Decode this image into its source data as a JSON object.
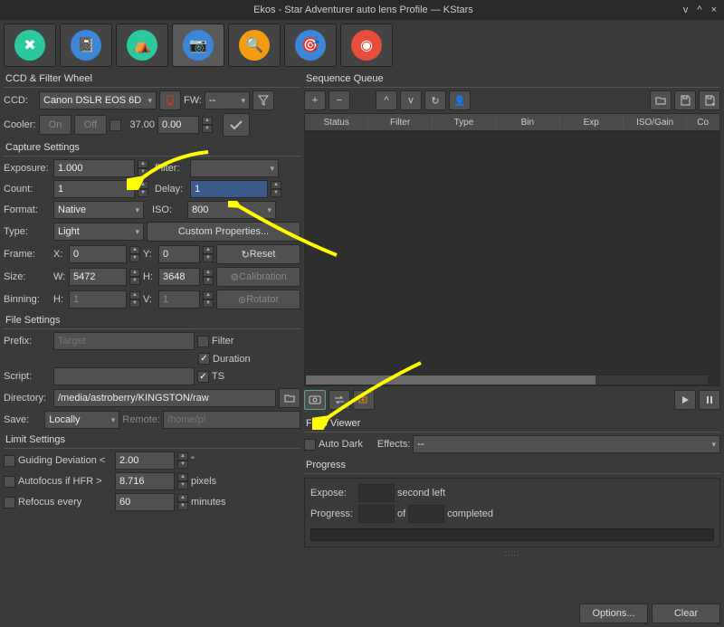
{
  "window": {
    "title": "Ekos - Star Adventurer auto lens Profile — KStars"
  },
  "sections": {
    "ccd_filter": "CCD & Filter Wheel",
    "capture": "Capture Settings",
    "file": "File Settings",
    "limit": "Limit Settings",
    "queue": "Sequence Queue",
    "fits": "FITS Viewer",
    "progress": "Progress"
  },
  "ccd": {
    "ccd_label": "CCD:",
    "ccd_val": "Canon DSLR EOS 6D",
    "fw_label": "FW:",
    "fw_val": "--",
    "cooler_label": "Cooler:",
    "cooler_on": "On",
    "cooler_off": "Off",
    "temp_actual": "37.00",
    "temp_set": "0.00"
  },
  "capture": {
    "exposure_label": "Exposure:",
    "exposure_val": "1.000",
    "filter_label": "Filter:",
    "filter_val": "",
    "count_label": "Count:",
    "count_val": "1",
    "delay_label": "Delay:",
    "delay_val": "1",
    "format_label": "Format:",
    "format_val": "Native",
    "iso_label": "ISO:",
    "iso_val": "800",
    "type_label": "Type:",
    "type_val": "Light",
    "custom_props": "Custom Properties...",
    "frame_label": "Frame:",
    "x_label": "X:",
    "x_val": "0",
    "y_label": "Y:",
    "y_val": "0",
    "reset": "Reset",
    "size_label": "Size:",
    "w_label": "W:",
    "w_val": "5472",
    "h_label": "H:",
    "h_val": "3648",
    "calibration": "Calibration",
    "binning_label": "Binning:",
    "bh_label": "H:",
    "bh_val": "1",
    "bv_label": "V:",
    "bv_val": "1",
    "rotator": "Rotator"
  },
  "file": {
    "prefix_label": "Prefix:",
    "prefix_ph": "Target",
    "filter_chk": "Filter",
    "duration_chk": "Duration",
    "ts_chk": "TS",
    "script_label": "Script:",
    "dir_label": "Directory:",
    "dir_val": "/media/astroberry/KINGSTON/raw",
    "save_label": "Save:",
    "save_val": "Locally",
    "remote_label": "Remote:",
    "remote_ph": "/home/pi"
  },
  "limit": {
    "guiding": "Guiding Deviation <",
    "guiding_val": "2.00",
    "guiding_unit": "\"",
    "autofocus": "Autofocus if HFR >",
    "autofocus_val": "8.716",
    "autofocus_unit": "pixels",
    "refocus": "Refocus every",
    "refocus_val": "60",
    "refocus_unit": "minutes"
  },
  "queue": {
    "cols": [
      "Status",
      "Filter",
      "Type",
      "Bin",
      "Exp",
      "ISO/Gain",
      "Co"
    ],
    "add": "+",
    "remove": "−"
  },
  "fits": {
    "autodark": "Auto Dark",
    "effects_label": "Effects:",
    "effects_val": "--"
  },
  "progress": {
    "expose_label": "Expose:",
    "expose_unit": "second left",
    "progress_label": "Progress:",
    "of": "of",
    "completed": "completed"
  },
  "footer": {
    "options": "Options...",
    "clear": "Clear"
  }
}
